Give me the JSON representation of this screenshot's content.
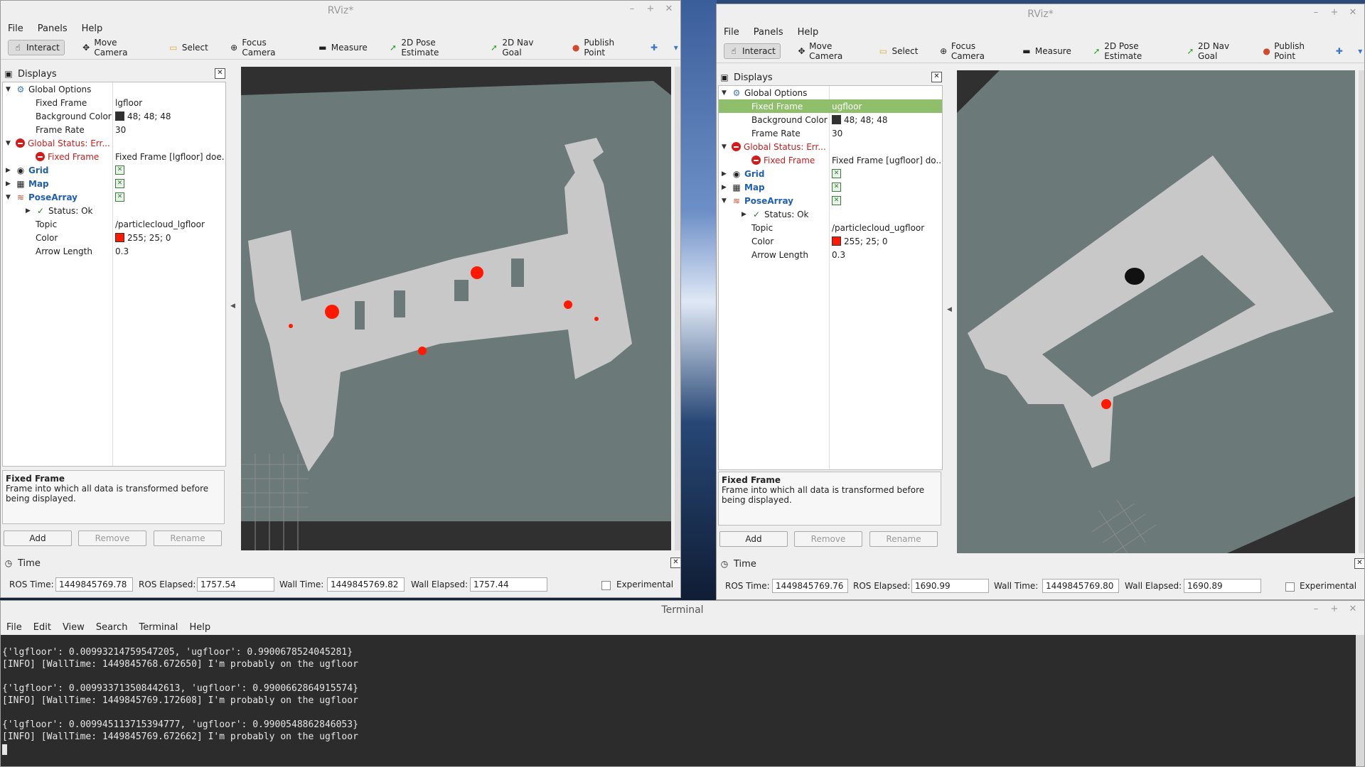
{
  "window_left": {
    "title": "RViz*",
    "menus": [
      "File",
      "Panels",
      "Help"
    ],
    "tools": [
      {
        "label": "Interact",
        "icon": "cursor-icon",
        "active": true
      },
      {
        "label": "Move Camera",
        "icon": "move-camera-icon",
        "active": false
      },
      {
        "label": "Select",
        "icon": "select-icon",
        "active": false
      },
      {
        "label": "Focus Camera",
        "icon": "focus-camera-icon",
        "active": false
      },
      {
        "label": "Measure",
        "icon": "measure-icon",
        "active": false
      },
      {
        "label": "2D Pose Estimate",
        "icon": "pose-estimate-icon",
        "active": false
      },
      {
        "label": "2D Nav Goal",
        "icon": "nav-goal-icon",
        "active": false
      },
      {
        "label": "Publish Point",
        "icon": "publish-point-icon",
        "active": false
      }
    ],
    "displays_title": "Displays",
    "rows": [
      {
        "name": "Global Options",
        "value": "",
        "indent": 0,
        "arrow": "down",
        "icon": "global-options-icon",
        "style": ""
      },
      {
        "name": "Fixed Frame",
        "value": "lgfloor",
        "indent": 1,
        "arrow": "",
        "icon": "",
        "style": ""
      },
      {
        "name": "Background Color",
        "value": "48; 48; 48",
        "indent": 1,
        "arrow": "",
        "icon": "",
        "style": "",
        "swatch": "#303030"
      },
      {
        "name": "Frame Rate",
        "value": "30",
        "indent": 1,
        "arrow": "",
        "icon": "",
        "style": ""
      },
      {
        "name": "Global Status: Err...",
        "value": "",
        "indent": 0,
        "arrow": "down",
        "icon": "error-icon",
        "style": "err"
      },
      {
        "name": "Fixed Frame",
        "value": "Fixed Frame [lgfloor] doe...",
        "indent": 1,
        "arrow": "",
        "icon": "error-icon",
        "style": "err"
      },
      {
        "name": "Grid",
        "value": "",
        "indent": 0,
        "arrow": "right",
        "icon": "grid-icon",
        "style": "blue",
        "check": true
      },
      {
        "name": "Map",
        "value": "",
        "indent": 0,
        "arrow": "right",
        "icon": "map-icon",
        "style": "blue",
        "check": true
      },
      {
        "name": "PoseArray",
        "value": "",
        "indent": 0,
        "arrow": "down",
        "icon": "posearray-icon",
        "style": "blue",
        "check": true
      },
      {
        "name": "Status: Ok",
        "value": "",
        "indent": 1,
        "arrow": "right",
        "icon": "ok-check-icon",
        "style": ""
      },
      {
        "name": "Topic",
        "value": "/particlecloud_lgfloor",
        "indent": 1,
        "arrow": "",
        "icon": "",
        "style": ""
      },
      {
        "name": "Color",
        "value": "255; 25; 0",
        "indent": 1,
        "arrow": "",
        "icon": "",
        "style": "",
        "swatch": "#ff1900"
      },
      {
        "name": "Arrow Length",
        "value": "0.3",
        "indent": 1,
        "arrow": "",
        "icon": "",
        "style": ""
      }
    ],
    "desc_title": "Fixed Frame",
    "desc_text": "Frame into which all data is transformed before being displayed.",
    "buttons": {
      "add": "Add",
      "remove": "Remove",
      "rename": "Rename"
    },
    "time": {
      "title": "Time",
      "ros_time_label": "ROS Time:",
      "ros_time": "1449845769.78",
      "ros_elapsed_label": "ROS Elapsed:",
      "ros_elapsed": "1757.54",
      "wall_time_label": "Wall Time:",
      "wall_time": "1449845769.82",
      "wall_elapsed_label": "Wall Elapsed:",
      "wall_elapsed": "1757.44",
      "experimental": "Experimental"
    }
  },
  "window_right": {
    "title": "RViz*",
    "menus": [
      "File",
      "Panels",
      "Help"
    ],
    "tools": [
      {
        "label": "Interact",
        "icon": "cursor-icon",
        "active": true
      },
      {
        "label": "Move Camera",
        "icon": "move-camera-icon",
        "active": false
      },
      {
        "label": "Select",
        "icon": "select-icon",
        "active": false
      },
      {
        "label": "Focus Camera",
        "icon": "focus-camera-icon",
        "active": false
      },
      {
        "label": "Measure",
        "icon": "measure-icon",
        "active": false
      },
      {
        "label": "2D Pose Estimate",
        "icon": "pose-estimate-icon",
        "active": false
      },
      {
        "label": "2D Nav Goal",
        "icon": "nav-goal-icon",
        "active": false
      },
      {
        "label": "Publish Point",
        "icon": "publish-point-icon",
        "active": false
      }
    ],
    "displays_title": "Displays",
    "rows": [
      {
        "name": "Global Options",
        "value": "",
        "indent": 0,
        "arrow": "down",
        "icon": "global-options-icon",
        "style": ""
      },
      {
        "name": "Fixed Frame",
        "value": "ugfloor",
        "indent": 1,
        "arrow": "",
        "icon": "",
        "style": "",
        "selected": true
      },
      {
        "name": "Background Color",
        "value": "48; 48; 48",
        "indent": 1,
        "arrow": "",
        "icon": "",
        "style": "",
        "swatch": "#303030"
      },
      {
        "name": "Frame Rate",
        "value": "30",
        "indent": 1,
        "arrow": "",
        "icon": "",
        "style": ""
      },
      {
        "name": "Global Status: Err...",
        "value": "",
        "indent": 0,
        "arrow": "down",
        "icon": "error-icon",
        "style": "err"
      },
      {
        "name": "Fixed Frame",
        "value": "Fixed Frame [ugfloor] do...",
        "indent": 1,
        "arrow": "",
        "icon": "error-icon",
        "style": "err"
      },
      {
        "name": "Grid",
        "value": "",
        "indent": 0,
        "arrow": "right",
        "icon": "grid-icon",
        "style": "blue",
        "check": true
      },
      {
        "name": "Map",
        "value": "",
        "indent": 0,
        "arrow": "right",
        "icon": "map-icon",
        "style": "blue",
        "check": true
      },
      {
        "name": "PoseArray",
        "value": "",
        "indent": 0,
        "arrow": "down",
        "icon": "posearray-icon",
        "style": "blue",
        "check": true
      },
      {
        "name": "Status: Ok",
        "value": "",
        "indent": 1,
        "arrow": "right",
        "icon": "ok-check-icon",
        "style": ""
      },
      {
        "name": "Topic",
        "value": "/particlecloud_ugfloor",
        "indent": 1,
        "arrow": "",
        "icon": "",
        "style": ""
      },
      {
        "name": "Color",
        "value": "255; 25; 0",
        "indent": 1,
        "arrow": "",
        "icon": "",
        "style": "",
        "swatch": "#ff1900"
      },
      {
        "name": "Arrow Length",
        "value": "0.3",
        "indent": 1,
        "arrow": "",
        "icon": "",
        "style": ""
      }
    ],
    "desc_title": "Fixed Frame",
    "desc_text": "Frame into which all data is transformed before being displayed.",
    "buttons": {
      "add": "Add",
      "remove": "Remove",
      "rename": "Rename"
    },
    "time": {
      "title": "Time",
      "ros_time_label": "ROS Time:",
      "ros_time": "1449845769.76",
      "ros_elapsed_label": "ROS Elapsed:",
      "ros_elapsed": "1690.99",
      "wall_time_label": "Wall Time:",
      "wall_time": "1449845769.80",
      "wall_elapsed_label": "Wall Elapsed:",
      "wall_elapsed": "1690.89",
      "experimental": "Experimental"
    }
  },
  "terminal": {
    "title": "Terminal",
    "menus": [
      "File",
      "Edit",
      "View",
      "Search",
      "Terminal",
      "Help"
    ],
    "lines": [
      "{'lgfloor': 0.009932147595472​05, 'ugfloor': 0.9900678524045281}",
      "[INFO] [WallTime: 1449845768.672650] I'm probably on the ugfloor",
      "",
      "{'lgfloor': 0.009933713508442613, 'ugfloor': 0.9900662864915574}",
      "[INFO] [WallTime: 1449845769.172608] I'm probably on the ugfloor",
      "",
      "{'lgfloor': 0.009945113715394777, 'ugfloor': 0.9900548862846053}",
      "[INFO] [WallTime: 1449845769.672662] I'm probably on the ugfloor"
    ]
  },
  "colors": {
    "map_free": "#c8c8c8",
    "map_unknown": "#6b7a79",
    "viewport_bg": "#303030",
    "particles": "#ff1900",
    "error": "#c81e1e",
    "selected_row": "#8fbf6a"
  }
}
